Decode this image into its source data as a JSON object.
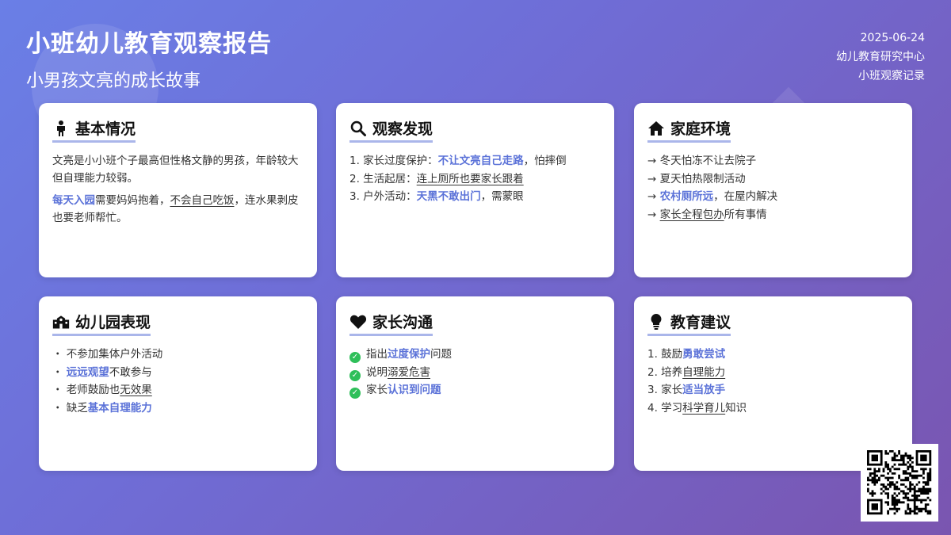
{
  "header": {
    "title": "小班幼儿教育观察报告",
    "subtitle": "小男孩文亮的成长故事",
    "date": "2025-06-24",
    "org": "幼儿教育研究中心",
    "record": "小班观察记录"
  },
  "cards": {
    "basic": {
      "title": "基本情况",
      "icon": "person-icon",
      "p1": "文亮是小小班个子最高但性格文静的男孩，年龄较大但自理能力较弱。",
      "p2_hl": "每天入园",
      "p2_a": "需要妈妈抱着，",
      "p2_ul": "不会自己吃饭",
      "p2_b": "，连水果剥皮也要老师帮忙。"
    },
    "observe": {
      "title": "观察发现",
      "icon": "search-icon",
      "items": [
        {
          "pre": "1. 家长过度保护：",
          "hl": "不让文亮自己走路",
          "post": "，怕摔倒"
        },
        {
          "pre": "2. 生活起居：",
          "ul": "连上厕所也要家长跟着"
        },
        {
          "pre": "3. 户外活动：",
          "hl": "天黑不敢出门",
          "post": "，需蒙眼"
        }
      ]
    },
    "family": {
      "title": "家庭环境",
      "icon": "home-icon",
      "items": [
        {
          "pre": "→ 冬天怕冻不让去院子"
        },
        {
          "pre": "→ 夏天怕热限制活动"
        },
        {
          "pre": "→ ",
          "hl": "农村厕所远",
          "post": "，在屋内解决"
        },
        {
          "pre": "→ ",
          "ul": "家长全程包办",
          "post": "所有事情"
        }
      ]
    },
    "kinder": {
      "title": "幼儿园表现",
      "icon": "school-icon",
      "items": [
        {
          "pre": "・ 不参加集体户外活动"
        },
        {
          "pre": "・ ",
          "hl": "远远观望",
          "post": "不敢参与"
        },
        {
          "pre": "・ 老师鼓励也",
          "ul": "无效果"
        },
        {
          "pre": "・ 缺乏",
          "hl": "基本自理能力"
        }
      ]
    },
    "parent": {
      "title": "家长沟通",
      "icon": "heart-icon",
      "items": [
        {
          "pre": "指出",
          "hl": "过度保护",
          "post": "问题"
        },
        {
          "pre": "说明",
          "ul": "溺爱危害"
        },
        {
          "pre": "家长",
          "hl": "认识到问题"
        }
      ]
    },
    "advice": {
      "title": "教育建议",
      "icon": "lightbulb-icon",
      "items": [
        {
          "pre": "1. 鼓励",
          "hl": "勇敢尝试"
        },
        {
          "pre": "2. 培养",
          "ul": "自理能力"
        },
        {
          "pre": "3. 家长",
          "hl": "适当放手"
        },
        {
          "pre": "4. 学习",
          "ul": "科学育儿",
          "post": "知识"
        }
      ]
    }
  },
  "colors": {
    "accent": "#5b72d8",
    "check": "#2fbf5a"
  },
  "qr": {
    "icon": "qr-code-icon"
  }
}
